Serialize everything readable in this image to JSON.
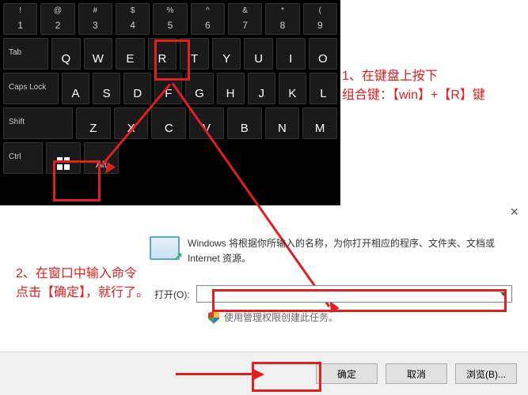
{
  "keyboard": {
    "row0": [
      {
        "upper": "!",
        "lower": "1"
      },
      {
        "upper": "@",
        "lower": "2"
      },
      {
        "upper": "#",
        "lower": "3"
      },
      {
        "upper": "$",
        "lower": "4"
      },
      {
        "upper": "%",
        "lower": "5"
      },
      {
        "upper": "^",
        "lower": "6"
      },
      {
        "upper": "&",
        "lower": "7"
      },
      {
        "upper": "*",
        "lower": "8"
      },
      {
        "upper": "(",
        "lower": "9"
      }
    ],
    "row1_mod": "Tab",
    "row1": [
      "Q",
      "W",
      "E",
      "R",
      "T",
      "Y",
      "U",
      "I",
      "O"
    ],
    "row2_mod": "Caps Lock",
    "row2": [
      "A",
      "S",
      "D",
      "F",
      "G",
      "H",
      "J",
      "K",
      "L"
    ],
    "row3_mod": "Shift",
    "row3": [
      "Z",
      "X",
      "C",
      "V",
      "B",
      "N",
      "M"
    ],
    "row4": {
      "ctrl": "Ctrl",
      "alt": "Alt"
    }
  },
  "annotations": {
    "step1_line1": "1、在键盘上按下",
    "step1_line2": "组合键：【win】+【R】键",
    "step2_line1": "2、在窗口中输入命令",
    "step2_line2": "点击【确定】，就行了。"
  },
  "dialog": {
    "description": "Windows 将根据你所输入的名称，为你打开相应的程序、文件夹、文档或 Internet 资源。",
    "open_label": "打开(O):",
    "input_value": "",
    "admin_text": "使用管理权限创建此任务。",
    "ok": "确定",
    "cancel": "取消",
    "browse": "浏览(B)..."
  },
  "close": "×"
}
